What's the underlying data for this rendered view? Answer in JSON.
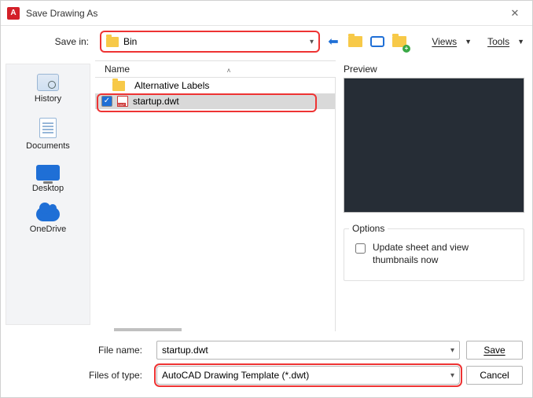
{
  "titlebar": {
    "app_letter": "A",
    "title": "Save Drawing As"
  },
  "toprow": {
    "savein_label": "Save in:",
    "folder": "Bin",
    "menu_views": "Views",
    "menu_tools": "Tools"
  },
  "places": {
    "history": "History",
    "documents": "Documents",
    "desktop": "Desktop",
    "onedrive": "OneDrive"
  },
  "list": {
    "col_name": "Name",
    "items": [
      {
        "label": "Alternative Labels",
        "type": "folder",
        "selected": false
      },
      {
        "label": "startup.dwt",
        "type": "dwt",
        "selected": true
      }
    ]
  },
  "right": {
    "preview_label": "Preview",
    "options_label": "Options",
    "update_label": "Update sheet and view thumbnails now"
  },
  "bottom": {
    "filename_label": "File name:",
    "filename_value": "startup.dwt",
    "filetype_label": "Files of type:",
    "filetype_value": "AutoCAD Drawing Template (*.dwt)",
    "save_label": "Save",
    "cancel_label": "Cancel"
  }
}
